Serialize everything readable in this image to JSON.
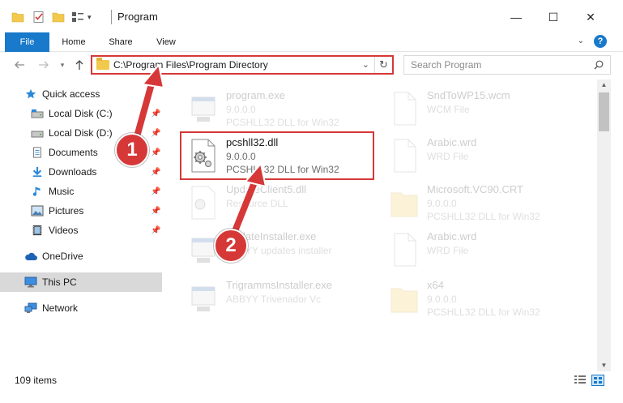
{
  "window": {
    "title": "Program",
    "minimize": "—",
    "maximize": "☐",
    "close": "✕"
  },
  "ribbon": {
    "tabs": [
      "File",
      "Home",
      "Share",
      "View"
    ],
    "help": "?"
  },
  "nav": {
    "address_path": "C:\\Program Files\\Program Directory",
    "search_placeholder": "Search Program"
  },
  "sidebar": {
    "items": [
      {
        "label": "Quick access",
        "icon": "star-icon",
        "pinned": false
      },
      {
        "label": "Local Disk (C:)",
        "icon": "drive-icon",
        "pinned": true
      },
      {
        "label": "Local Disk (D:)",
        "icon": "drive-icon",
        "pinned": true
      },
      {
        "label": "Documents",
        "icon": "documents-icon",
        "pinned": true
      },
      {
        "label": "Downloads",
        "icon": "download-icon",
        "pinned": true
      },
      {
        "label": "Music",
        "icon": "music-icon",
        "pinned": true
      },
      {
        "label": "Pictures",
        "icon": "pictures-icon",
        "pinned": true
      },
      {
        "label": "Videos",
        "icon": "videos-icon",
        "pinned": true
      },
      {
        "label": "OneDrive",
        "icon": "cloud-icon",
        "pinned": false
      },
      {
        "label": "This PC",
        "icon": "computer-icon",
        "pinned": false,
        "selected": true
      },
      {
        "label": "Network",
        "icon": "network-icon",
        "pinned": false
      }
    ]
  },
  "files": [
    {
      "name": "program.exe",
      "line2": "9.0.0.0",
      "line3": "PCSHLL32 DLL for Win32",
      "type": "exe",
      "faded": true
    },
    {
      "name": "SndToWP15.wcm",
      "line2": "WCM File",
      "line3": "",
      "type": "doc",
      "faded": true
    },
    {
      "name": "pcshll32.dll",
      "line2": "9.0.0.0",
      "line3": "PCSHLL32 DLL for Win32",
      "type": "dll",
      "faded": false,
      "selected": true
    },
    {
      "name": "Arabic.wrd",
      "line2": "WRD File",
      "line3": "",
      "type": "doc",
      "faded": true
    },
    {
      "name": "UpdateClient5.dll",
      "line2": "Resource DLL",
      "line3": "",
      "type": "dll",
      "faded": true
    },
    {
      "name": "Microsoft.VC90.CRT",
      "line2": "9.0.0.0",
      "line3": "PCSHLL32 DLL for Win32",
      "type": "folder",
      "faded": true
    },
    {
      "name": "UpdateInstaller.exe",
      "line2": "ABBYY updates installer",
      "line3": "",
      "type": "exe",
      "faded": true
    },
    {
      "name": "Arabic.wrd",
      "line2": "WRD File",
      "line3": "",
      "type": "doc",
      "faded": true
    },
    {
      "name": "TrigrammsInstaller.exe",
      "line2": "ABBYY Trivenador Vc",
      "line3": "",
      "type": "exe",
      "faded": true
    },
    {
      "name": "x64",
      "line2": "9.0.0.0",
      "line3": "PCSHLL32 DLL for Win32",
      "type": "folder",
      "faded": true
    }
  ],
  "status": {
    "item_count": "109 items"
  },
  "callouts": {
    "step1": "1",
    "step2": "2"
  },
  "colors": {
    "accent": "#1979ca",
    "highlight": "#d63838",
    "folder": "#f2c94c"
  }
}
